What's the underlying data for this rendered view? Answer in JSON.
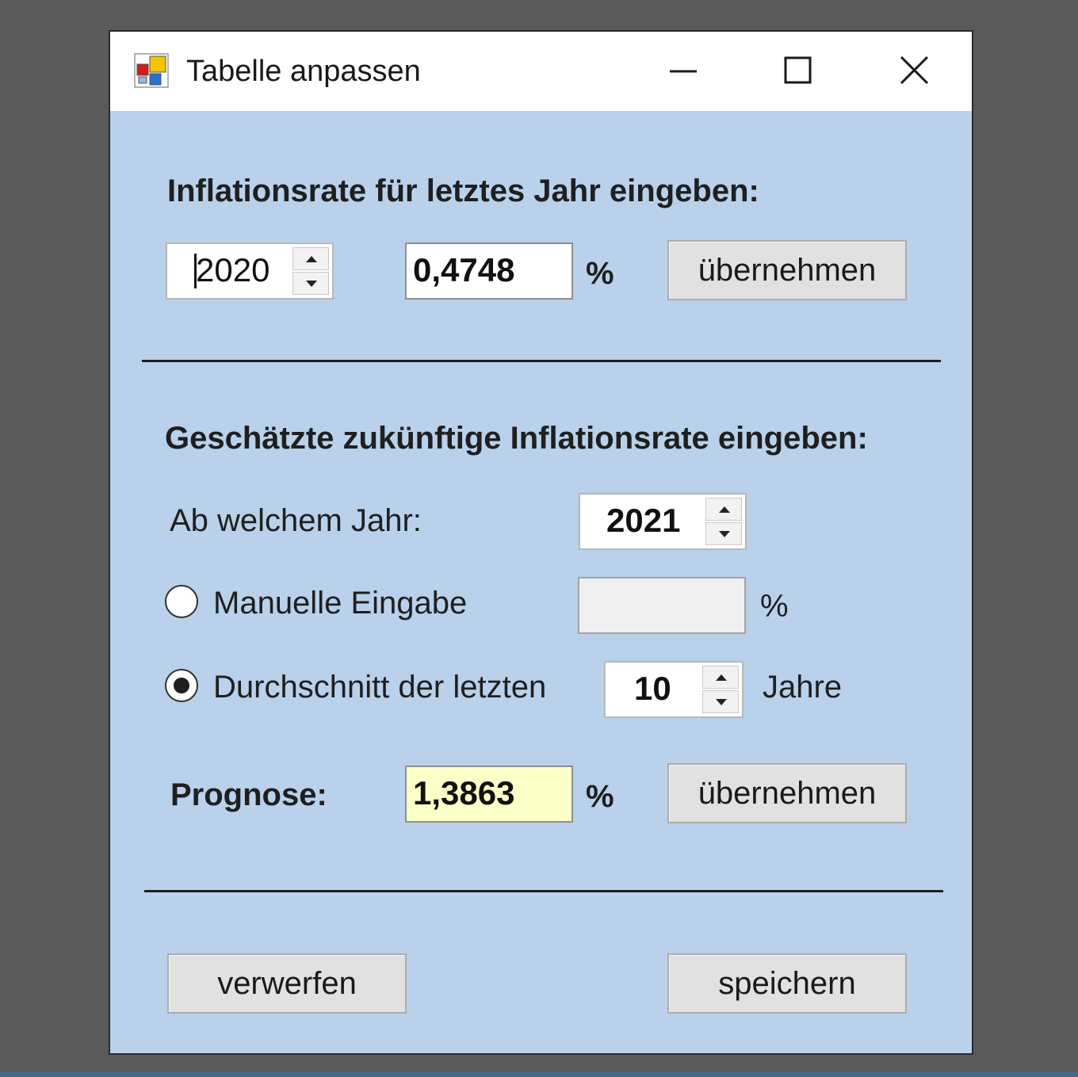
{
  "window": {
    "title": "Tabelle anpassen",
    "title_buttons": {
      "minimize": "minimize-icon",
      "maximize": "maximize-icon",
      "close": "close-icon"
    }
  },
  "section_last_year": {
    "heading": "Inflationsrate für letztes Jahr eingeben:",
    "year_value": "2020",
    "rate_value": "0,4748",
    "percent": "%",
    "apply_label": "übernehmen"
  },
  "section_future": {
    "heading": "Geschätzte zukünftige Inflationsrate eingeben:",
    "from_year_label": "Ab welchem Jahr:",
    "from_year_value": "2021",
    "manual_label": "Manuelle Eingabe",
    "manual_value": "",
    "manual_percent": "%",
    "average_label": "Durchschnitt der letzten",
    "average_years_value": "10",
    "years_label": "Jahre",
    "selected_mode": "average",
    "forecast_label": "Prognose:",
    "forecast_value": "1,3863",
    "forecast_percent": "%",
    "apply_label": "übernehmen"
  },
  "footer": {
    "discard_label": "verwerfen",
    "save_label": "speichern"
  },
  "colors": {
    "window_bg": "#b9d1ea",
    "desktop_bg": "#5a5a5a",
    "forecast_bg": "#fdffc8"
  }
}
